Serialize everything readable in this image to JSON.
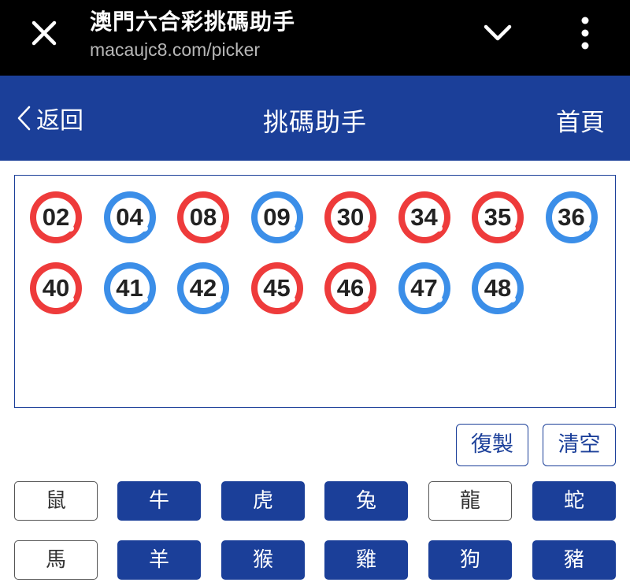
{
  "chrome": {
    "title": "澳門六合彩挑碼助手",
    "url": "macaujc8.com/picker"
  },
  "header": {
    "back_label": "返回",
    "title": "挑碼助手",
    "home_label": "首頁",
    "color": "#1b3f99"
  },
  "balls": [
    {
      "number": "02",
      "color": "red"
    },
    {
      "number": "04",
      "color": "blue"
    },
    {
      "number": "08",
      "color": "red"
    },
    {
      "number": "09",
      "color": "blue"
    },
    {
      "number": "30",
      "color": "red"
    },
    {
      "number": "34",
      "color": "red"
    },
    {
      "number": "35",
      "color": "red"
    },
    {
      "number": "36",
      "color": "blue"
    },
    {
      "number": "40",
      "color": "red"
    },
    {
      "number": "41",
      "color": "blue"
    },
    {
      "number": "42",
      "color": "blue"
    },
    {
      "number": "45",
      "color": "red"
    },
    {
      "number": "46",
      "color": "red"
    },
    {
      "number": "47",
      "color": "blue"
    },
    {
      "number": "48",
      "color": "blue"
    }
  ],
  "ball_colors": {
    "red": "#ee3b3b",
    "blue": "#3b8ee8"
  },
  "actions": {
    "copy_label": "復製",
    "clear_label": "清空"
  },
  "zodiacs": [
    {
      "label": "鼠",
      "selected": false
    },
    {
      "label": "牛",
      "selected": true
    },
    {
      "label": "虎",
      "selected": true
    },
    {
      "label": "兔",
      "selected": true
    },
    {
      "label": "龍",
      "selected": false
    },
    {
      "label": "蛇",
      "selected": true
    },
    {
      "label": "馬",
      "selected": false
    },
    {
      "label": "羊",
      "selected": true
    },
    {
      "label": "猴",
      "selected": true
    },
    {
      "label": "雞",
      "selected": true
    },
    {
      "label": "狗",
      "selected": true
    },
    {
      "label": "豬",
      "selected": true
    }
  ]
}
